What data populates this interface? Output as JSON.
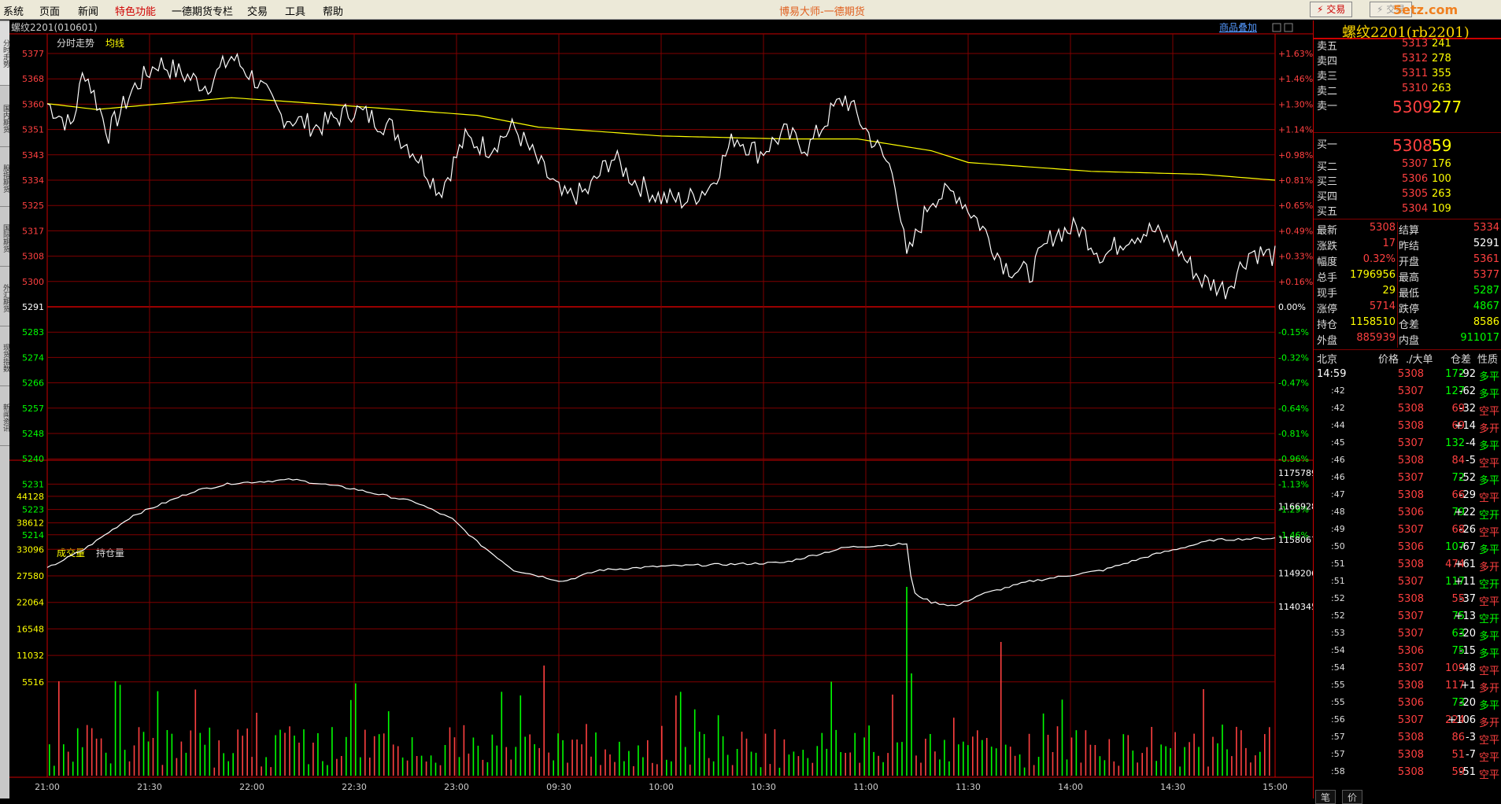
{
  "menu": [
    "系统",
    "页面",
    "新闻",
    "特色功能",
    "一德期货专栏",
    "交易",
    "工具",
    "帮助"
  ],
  "app_title": "博易大师-一德期货",
  "top_buttons": {
    "trade": "⚡ 交易",
    "other": "⚡ 交易"
  },
  "watermark": "5etz.com",
  "sidebar_tabs": [
    "分时走势",
    "国内期货",
    "股指期货",
    "国际期货",
    "外汇期货",
    "现货指数",
    "新闻资讯"
  ],
  "chart": {
    "symbol": "螺纹2201(010601)",
    "header_right": "商品叠加",
    "price_legend": {
      "line": "分时走势",
      "avg": "均线"
    },
    "volume_legend": {
      "vol": "成交量",
      "oi": "持仓量"
    },
    "price_ticks": [
      "5377",
      "5368",
      "5360",
      "5351",
      "5343",
      "5334",
      "5325",
      "5317",
      "5308",
      "5300",
      "5291",
      "5283",
      "5274",
      "5266",
      "5257",
      "5248",
      "5240",
      "5231",
      "5223",
      "5214"
    ],
    "pct_ticks": [
      "+1.63%",
      "+1.46%",
      "+1.30%",
      "+1.14%",
      "+0.98%",
      "+0.81%",
      "+0.65%",
      "+0.49%",
      "+0.33%",
      "+0.16%",
      "0.00%",
      "-0.15%",
      "-0.32%",
      "-0.47%",
      "-0.64%",
      "-0.81%",
      "-0.96%",
      "-1.13%",
      "-1.29%",
      "-1.46%"
    ],
    "vol_ticks": [
      "44128",
      "38612",
      "33096",
      "27580",
      "22064",
      "16548",
      "11032",
      "5516"
    ],
    "oi_ticks": [
      "1175789",
      "1166928",
      "1158067",
      "1149206",
      "1140345"
    ],
    "time_ticks": [
      "21:00",
      "21:30",
      "22:00",
      "22:30",
      "23:00",
      "09:30",
      "10:00",
      "10:30",
      "11:00",
      "11:30",
      "14:00",
      "14:30",
      "15:00"
    ],
    "colors": {
      "up": "#ff4040",
      "down": "#00ff00",
      "price_line": "#ffffff",
      "avg_line": "#ffff00",
      "grid": "#800000"
    }
  },
  "quote": {
    "title": "螺纹2201(rb2201)",
    "asks": [
      {
        "label": "卖五",
        "price": "5313",
        "vol": "241"
      },
      {
        "label": "卖四",
        "price": "5312",
        "vol": "278"
      },
      {
        "label": "卖三",
        "price": "5311",
        "vol": "355"
      },
      {
        "label": "卖二",
        "price": "5310",
        "vol": "263"
      },
      {
        "label": "卖一",
        "price": "5309",
        "vol": "277"
      }
    ],
    "bids": [
      {
        "label": "买一",
        "price": "5308",
        "vol": "59"
      },
      {
        "label": "买二",
        "price": "5307",
        "vol": "176"
      },
      {
        "label": "买三",
        "price": "5306",
        "vol": "100"
      },
      {
        "label": "买四",
        "price": "5305",
        "vol": "263"
      },
      {
        "label": "买五",
        "price": "5304",
        "vol": "109"
      }
    ],
    "stats": [
      {
        "l1": "最新",
        "v1": "5308",
        "c1": "red",
        "l2": "结算",
        "v2": "5334",
        "c2": "red"
      },
      {
        "l1": "涨跌",
        "v1": "17",
        "c1": "red",
        "l2": "昨结",
        "v2": "5291",
        "c2": "white"
      },
      {
        "l1": "幅度",
        "v1": "0.32%",
        "c1": "red",
        "l2": "开盘",
        "v2": "5361",
        "c2": "red"
      },
      {
        "l1": "总手",
        "v1": "1796956",
        "c1": "yellow",
        "l2": "最高",
        "v2": "5377",
        "c2": "red"
      },
      {
        "l1": "现手",
        "v1": "29",
        "c1": "yellow",
        "l2": "最低",
        "v2": "5287",
        "c2": "green"
      },
      {
        "l1": "涨停",
        "v1": "5714",
        "c1": "red",
        "l2": "跌停",
        "v2": "4867",
        "c2": "green"
      },
      {
        "l1": "持仓",
        "v1": "1158510",
        "c1": "yellow",
        "l2": "仓差",
        "v2": "8586",
        "c2": "yellow"
      },
      {
        "l1": "外盘",
        "v1": "885939",
        "c1": "red",
        "l2": "内盘",
        "v2": "911017",
        "c2": "green"
      }
    ],
    "tick_header": [
      "北京",
      "价格",
      "./大单",
      "仓差",
      "性质"
    ],
    "ticks": [
      {
        "t": "14:59",
        "p": "5308",
        "pc": "red",
        "v": "172",
        "vc": "green",
        "d": "-92",
        "dc": "white",
        "n": "多平",
        "nc": "green"
      },
      {
        "t": ":42",
        "p": "5307",
        "pc": "red",
        "v": "127",
        "vc": "green",
        "d": "-62",
        "dc": "white",
        "n": "多平",
        "nc": "green"
      },
      {
        "t": ":42",
        "p": "5308",
        "pc": "red",
        "v": "69",
        "vc": "red",
        "d": "-32",
        "dc": "white",
        "n": "空平",
        "nc": "red"
      },
      {
        "t": ":44",
        "p": "5308",
        "pc": "red",
        "v": "69",
        "vc": "red",
        "d": "+14",
        "dc": "white",
        "n": "多开",
        "nc": "red"
      },
      {
        "t": ":45",
        "p": "5307",
        "pc": "red",
        "v": "132",
        "vc": "green",
        "d": "-4",
        "dc": "white",
        "n": "多平",
        "nc": "green"
      },
      {
        "t": ":46",
        "p": "5308",
        "pc": "red",
        "v": "84",
        "vc": "red",
        "d": "-5",
        "dc": "white",
        "n": "空平",
        "nc": "red"
      },
      {
        "t": ":46",
        "p": "5307",
        "pc": "red",
        "v": "72",
        "vc": "green",
        "d": "-52",
        "dc": "white",
        "n": "多平",
        "nc": "green"
      },
      {
        "t": ":47",
        "p": "5308",
        "pc": "red",
        "v": "66",
        "vc": "red",
        "d": "-29",
        "dc": "white",
        "n": "空平",
        "nc": "red"
      },
      {
        "t": ":48",
        "p": "5306",
        "pc": "red",
        "v": "79",
        "vc": "green",
        "d": "+22",
        "dc": "white",
        "n": "空开",
        "nc": "green"
      },
      {
        "t": ":49",
        "p": "5307",
        "pc": "red",
        "v": "68",
        "vc": "red",
        "d": "-26",
        "dc": "white",
        "n": "空平",
        "nc": "red"
      },
      {
        "t": ":50",
        "p": "5306",
        "pc": "red",
        "v": "107",
        "vc": "green",
        "d": "-67",
        "dc": "white",
        "n": "多平",
        "nc": "green"
      },
      {
        "t": ":51",
        "p": "5308",
        "pc": "red",
        "v": "474",
        "vc": "red",
        "d": "+61",
        "dc": "white",
        "n": "多开",
        "nc": "red"
      },
      {
        "t": ":51",
        "p": "5307",
        "pc": "red",
        "v": "117",
        "vc": "green",
        "d": "+11",
        "dc": "white",
        "n": "空开",
        "nc": "green"
      },
      {
        "t": ":52",
        "p": "5308",
        "pc": "red",
        "v": "55",
        "vc": "red",
        "d": "-37",
        "dc": "white",
        "n": "空平",
        "nc": "red"
      },
      {
        "t": ":52",
        "p": "5307",
        "pc": "red",
        "v": "75",
        "vc": "green",
        "d": "+13",
        "dc": "white",
        "n": "空开",
        "nc": "green"
      },
      {
        "t": ":53",
        "p": "5307",
        "pc": "red",
        "v": "63",
        "vc": "green",
        "d": "-20",
        "dc": "white",
        "n": "多平",
        "nc": "green"
      },
      {
        "t": ":54",
        "p": "5306",
        "pc": "red",
        "v": "75",
        "vc": "green",
        "d": "-15",
        "dc": "white",
        "n": "多平",
        "nc": "green"
      },
      {
        "t": ":54",
        "p": "5307",
        "pc": "red",
        "v": "109",
        "vc": "red",
        "d": "-48",
        "dc": "white",
        "n": "空平",
        "nc": "red"
      },
      {
        "t": ":55",
        "p": "5308",
        "pc": "red",
        "v": "117",
        "vc": "red",
        "d": "+1",
        "dc": "white",
        "n": "多开",
        "nc": "red"
      },
      {
        "t": ":55",
        "p": "5306",
        "pc": "red",
        "v": "73",
        "vc": "green",
        "d": "-20",
        "dc": "white",
        "n": "多平",
        "nc": "green"
      },
      {
        "t": ":56",
        "p": "5307",
        "pc": "red",
        "v": "224",
        "vc": "red",
        "d": "+106",
        "dc": "white",
        "n": "多开",
        "nc": "red"
      },
      {
        "t": ":57",
        "p": "5308",
        "pc": "red",
        "v": "86",
        "vc": "red",
        "d": "-3",
        "dc": "white",
        "n": "空平",
        "nc": "red"
      },
      {
        "t": ":57",
        "p": "5308",
        "pc": "red",
        "v": "51",
        "vc": "red",
        "d": "-7",
        "dc": "white",
        "n": "空平",
        "nc": "red"
      },
      {
        "t": ":58",
        "p": "5308",
        "pc": "red",
        "v": "59",
        "vc": "red",
        "d": "-51",
        "dc": "white",
        "n": "空平",
        "nc": "red"
      }
    ],
    "bottom_tabs": [
      "笔",
      "价"
    ]
  }
}
